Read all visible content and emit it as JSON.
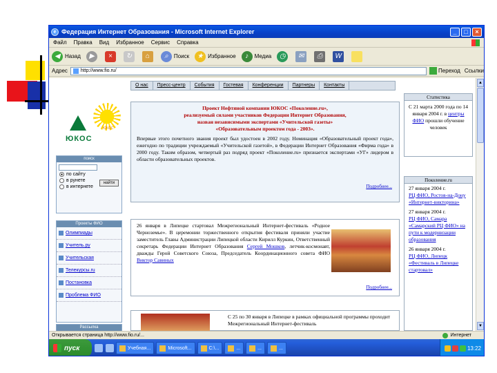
{
  "browser": {
    "title": "Федерация Интернет Образования - Microsoft Internet Explorer",
    "menu": [
      "Файл",
      "Правка",
      "Вид",
      "Избранное",
      "Сервис",
      "Справка"
    ],
    "toolbar": {
      "back": "Назад",
      "search": "Поиск",
      "favorites": "Избранное",
      "media": "Медиа"
    },
    "address_label": "Адрес",
    "address_value": "http://www.fio.ru/",
    "go_label": "Переход",
    "links_label": "Ссылки",
    "status_text": "Открывается страница http://www.fio.ru/...",
    "zone_text": "Интернет"
  },
  "site": {
    "brand": "ЮКОС",
    "sun_caption": "ЮКОС",
    "nav": [
      "О нас",
      "Пресс-центр",
      "События",
      "Гостевая",
      "Конференции",
      "Партнеры",
      "Контакты"
    ],
    "search": {
      "header": "поиск",
      "button": "найти",
      "options": [
        "по сайту",
        "в рунете",
        "в интернете"
      ]
    },
    "projects": {
      "header": "Проекты ФИО",
      "items": [
        "Олимпиады",
        "Учитель.ру",
        "Учительская",
        "Телекурсы.ru",
        "Постановка",
        "Проблема ФИО"
      ]
    },
    "distribution_header": "Рассылка",
    "project_block": {
      "title_lines": [
        "Проект Нефтяной компании ЮКОС «Поколение.ru»,",
        "реализуемый силами участников Федерации Интернет Образования,",
        "назван независимыми экспертами «Учительской газеты»",
        "«Образовательным проектом года - 2003»."
      ],
      "body": "Впервые этого почетного звания проект был удостоен в 2002 году. Номинация «Образовательный проект года», ежегодно по традиции учреждаемый «Учительской газетой», в Федерации Интернет Образования «Фирма года» в 2000 году. Таким образом, четвертый раз подряд проект «Поколение.ru» признается экспертами «УГ» лидером в области образовательных проектов.",
      "more": "Подробнее..."
    },
    "news1": {
      "text_before": "26 января в Липецке стартовал Межрегиональный Интернет-фестиваль «Родное Черноземье». В церемонии торжественного открытия фестиваля приняли участие заместитель Главы Администрации Липецкой области Кирилл Куркин, Ответственный секретарь Федерации Интернет Образования",
      "link1": "Сергей Мошков",
      "text_middle": ", летчик-космонавт, дважды Герой Советского Союза, Председатель Координационного совета ФИО",
      "link2": "Виктор Савиных",
      "more": "Подробнее..."
    },
    "news2": {
      "text": "С 25 по 30 января в Липецке в рамках официальной программы проходит Межрегиональный Интернет-фестиваль"
    },
    "stats": {
      "header": "Статистика",
      "text": "С 21 марта 2000 года по 14 января 2004 г. в",
      "link": "центры ФИО",
      "text2": "прошли обучение",
      "count": "человек"
    },
    "events": {
      "header": "Поколение.ru",
      "items": [
        {
          "date": "27 января 2004 г.",
          "link": "РЦ ФИО, Ростов-на-Дону «Интернет-викторина»"
        },
        {
          "date": "27 января 2004 г.",
          "link": "РЦ ФИО, Самара «Самарский РЦ ФИО» на пути к модернизации образования"
        },
        {
          "date": "26 января 2004 г.",
          "link": "РЦ ФИО, Липецк «Фестиваль в Липецке стартовал»"
        }
      ]
    }
  },
  "taskbar": {
    "start": "пуск",
    "tasks": [
      "Учебная...",
      "Microsoft...",
      "C:\\...",
      "...",
      "...",
      "...",
      "..."
    ],
    "clock": "13:22"
  },
  "colors": {
    "xp_blue": "#245edb",
    "start_green": "#3c9a3c",
    "project_title_red": "#b00000",
    "link_blue": "#0000cc"
  }
}
